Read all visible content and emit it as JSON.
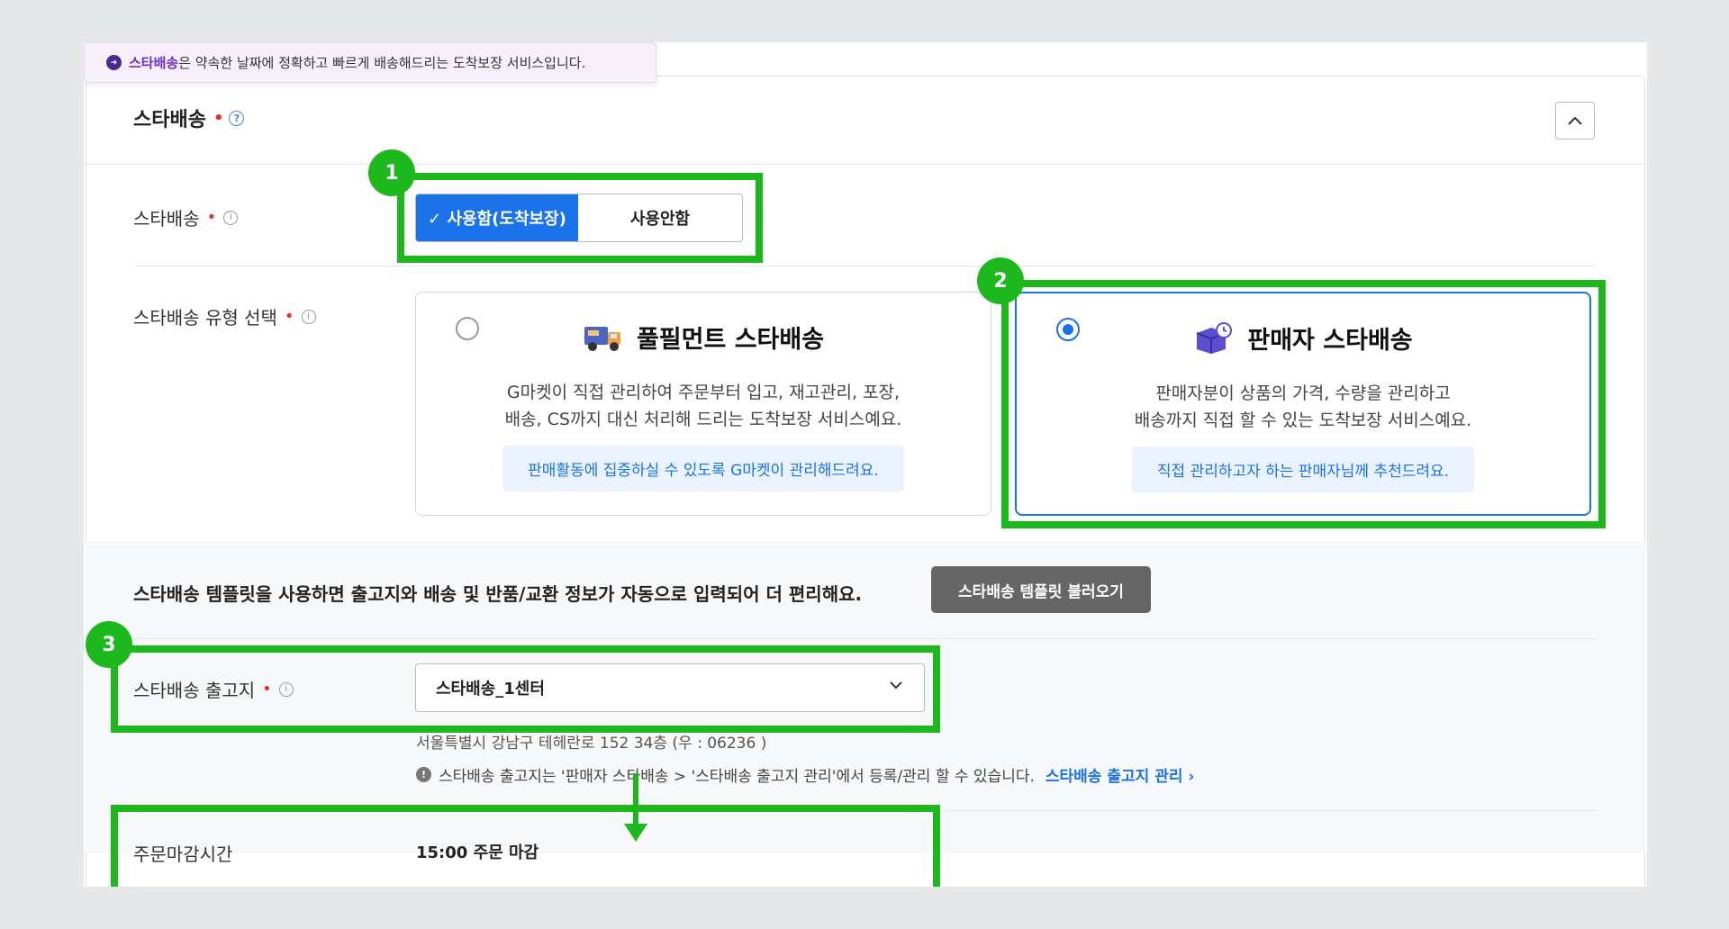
{
  "banner": {
    "highlight": "스타배송",
    "text": "은 약속한 날짜에 정확하고 빠르게 배송해드리는 도착보장 서비스입니다."
  },
  "section": {
    "title": "스타배송",
    "required_mark": "•",
    "help_glyph": "?",
    "collapse_glyph": "︿"
  },
  "usage": {
    "label": "스타배송",
    "on_label": "✓ 사용함(도착보장)",
    "off_label": "사용안함",
    "selected": "on"
  },
  "type_select": {
    "label": "스타배송 유형 선택",
    "cards": [
      {
        "title": "풀필먼트 스타배송",
        "icon": "truck-icon",
        "desc_line1": "G마켓이 직접 관리하여 주문부터 입고, 재고관리, 포장,",
        "desc_line2": "배송, CS까지 대신 처리해 드리는 도착보장 서비스예요.",
        "pill": "판매활동에 집중하실 수 있도록 G마켓이 관리해드려요.",
        "selected": false
      },
      {
        "title": "판매자 스타배송",
        "icon": "box-clock-icon",
        "desc_line1": "판매자분이 상품의 가격, 수량을 관리하고",
        "desc_line2": "배송까지 직접 할 수 있는 도착보장 서비스예요.",
        "pill": "직접 관리하고자 하는 판매자님께 추천드려요.",
        "selected": true
      }
    ]
  },
  "template": {
    "text": "스타배송 템플릿을 사용하면 출고지와 배송 및 반품/교환 정보가 자동으로 입력되어 더 편리해요.",
    "button": "스타배송 템플릿 불러오기"
  },
  "warehouse": {
    "label": "스타배송 출고지",
    "selected": "스타배송_1센터",
    "address": "서울특별시 강남구 테헤란로 152 34층 (우 : 06236 )",
    "note": "스타배송 출고지는 '판매자 스타배송 > '스타배송 출고지 관리'에서 등록/관리 할 수 있습니다.",
    "note_link": "스타배송 출고지 관리 ›"
  },
  "cutoff": {
    "label": "주문마감시간",
    "value": "15:00 주문 마감"
  },
  "annotations": {
    "n1": "1",
    "n2": "2",
    "n3": "3",
    "color": "#1db81d"
  },
  "colors": {
    "accent": "#1a73e8",
    "required": "#e1312a",
    "banner_highlight": "#6b2fd3"
  }
}
